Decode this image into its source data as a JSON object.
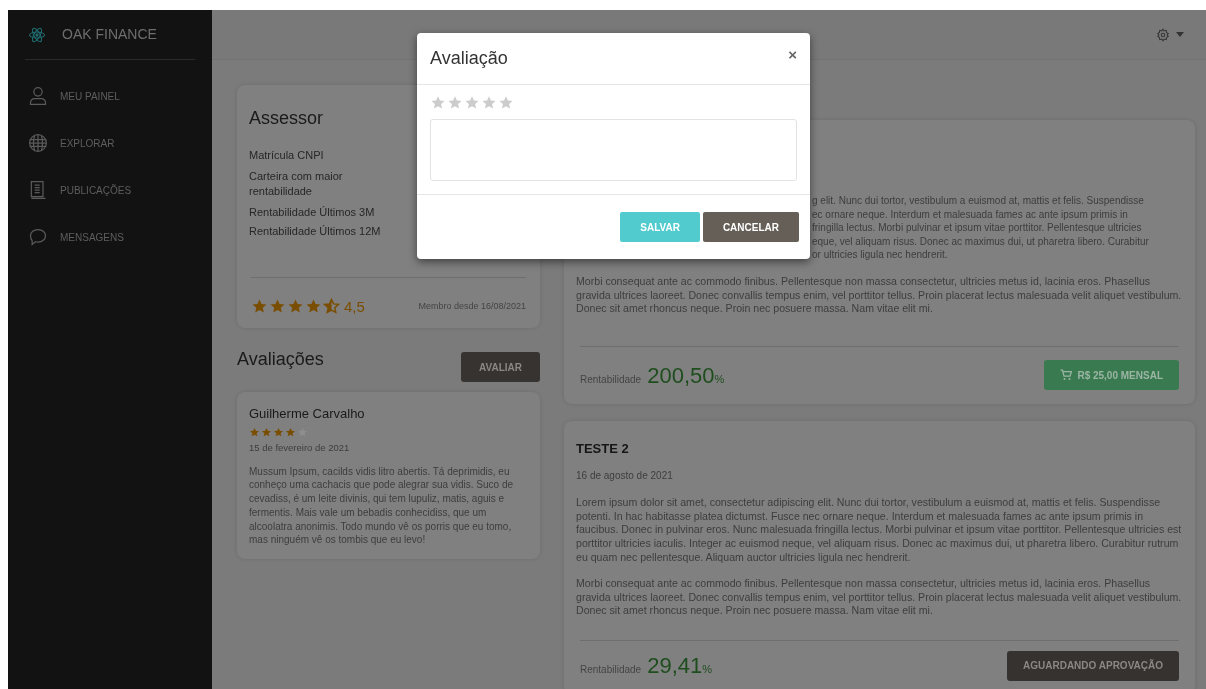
{
  "sidebar": {
    "brand": "OAK FINANCE",
    "items": [
      {
        "kind": "user",
        "label": "MEU PAINEL"
      },
      {
        "kind": "globe",
        "label": "EXPLORAR"
      },
      {
        "kind": "document",
        "label": "PUBLICAÇÕES"
      },
      {
        "kind": "chat",
        "label": "MENSAGENS"
      }
    ]
  },
  "assessor": {
    "title": "Assessor",
    "fields": [
      "Matrícula CNPI",
      "Carteira com maior rentabilidade",
      "Rentabilidade Últimos 3M",
      "Rentabilidade Últimos 12M"
    ],
    "stars": 4.5,
    "rating": "4,5",
    "member_since": "Membro desde 16/08/2021"
  },
  "reviews_section": {
    "title": "Avaliações",
    "button": "AVALIAR",
    "reviews": [
      {
        "name": "Guilherme Carvalho",
        "stars": 4,
        "date": "15 de fevereiro de 2021",
        "text": "Mussum Ipsum, cacilds vidis litro abertis. Tá deprimidis, eu conheço uma cachacis que pode alegrar sua vidis. Suco de cevadiss, é um leite divinis, qui tem lupuliz, matis, aguis e fermentis. Mais vale um bebadis conhecidiss, que um alcoolatra anonimis. Todo mundo vê os porris que eu tomo, mas ninguém vê os tombis que eu levo!"
      }
    ]
  },
  "posts": [
    {
      "paragraph_fragments": [
        "g elit. Nunc dui tortor, vestibulum a euismod at, mattis et felis. Suspendisse",
        "ec ornare neque. Interdum et malesuada fames ac ante ipsum primis in",
        "fringilla lectus. Morbi pulvinar et ipsum vitae porttitor. Pellentesque ultricies",
        "eque, vel aliquam risus. Donec ac maximus dui, ut pharetra libero. Curabitur",
        "or ultricies ligula nec hendrerit."
      ],
      "paragraphs": [
        "Morbi consequat ante ac commodo finibus. Pellentesque non massa consectetur, ultricies metus id, lacinia eros. Phasellus gravida ultrices laoreet. Donec convallis tempus enim, vel porttitor tellus. Proin placerat lectus malesuada velit aliquet vestibulum. Donec sit amet rhoncus neque. Proin nec posuere massa. Nam vitae elit mi."
      ],
      "label": "Rentabilidade",
      "value": "200,50",
      "unit": "%",
      "button": {
        "kind": "buy",
        "label": "R$ 25,00 MENSAL"
      }
    },
    {
      "title": "TESTE 2",
      "date": "16 de agosto de 2021",
      "paragraphs": [
        "Lorem ipsum dolor sit amet, consectetur adipiscing elit. Nunc dui tortor, vestibulum a euismod at, mattis et felis. Suspendisse potenti. In hac habitasse platea dictumst. Fusce nec ornare neque. Interdum et malesuada fames ac ante ipsum primis in faucibus. Donec in pulvinar eros. Nunc malesuada fringilla lectus. Morbi pulvinar et ipsum vitae porttitor. Pellentesque ultricies est porttitor ultricies iaculis. Integer ac euismod neque, vel aliquam risus. Donec ac maximus dui, ut pharetra libero. Curabitur rutrum eu quam nec pellentesque. Aliquam auctor ultricies ligula nec hendrerit.",
        "Morbi consequat ante ac commodo finibus. Pellentesque non massa consectetur, ultricies metus id, lacinia eros. Phasellus gravida ultrices laoreet. Donec convallis tempus enim, vel porttitor tellus. Proin placerat lectus malesuada velit aliquet vestibulum. Donec sit amet rhoncus neque. Proin nec posuere massa. Nam vitae elit mi."
      ],
      "label": "Rentabilidade",
      "value": "29,41",
      "unit": "%",
      "button": {
        "kind": "pending",
        "label": "AGUARDANDO APROVAÇÃO"
      }
    }
  ],
  "modal": {
    "title": "Avaliação",
    "close": "×",
    "stars": 0,
    "buttons": [
      {
        "kind": "primary",
        "label": "SALVAR"
      },
      {
        "kind": "secondary",
        "label": "CANCELAR"
      }
    ]
  }
}
